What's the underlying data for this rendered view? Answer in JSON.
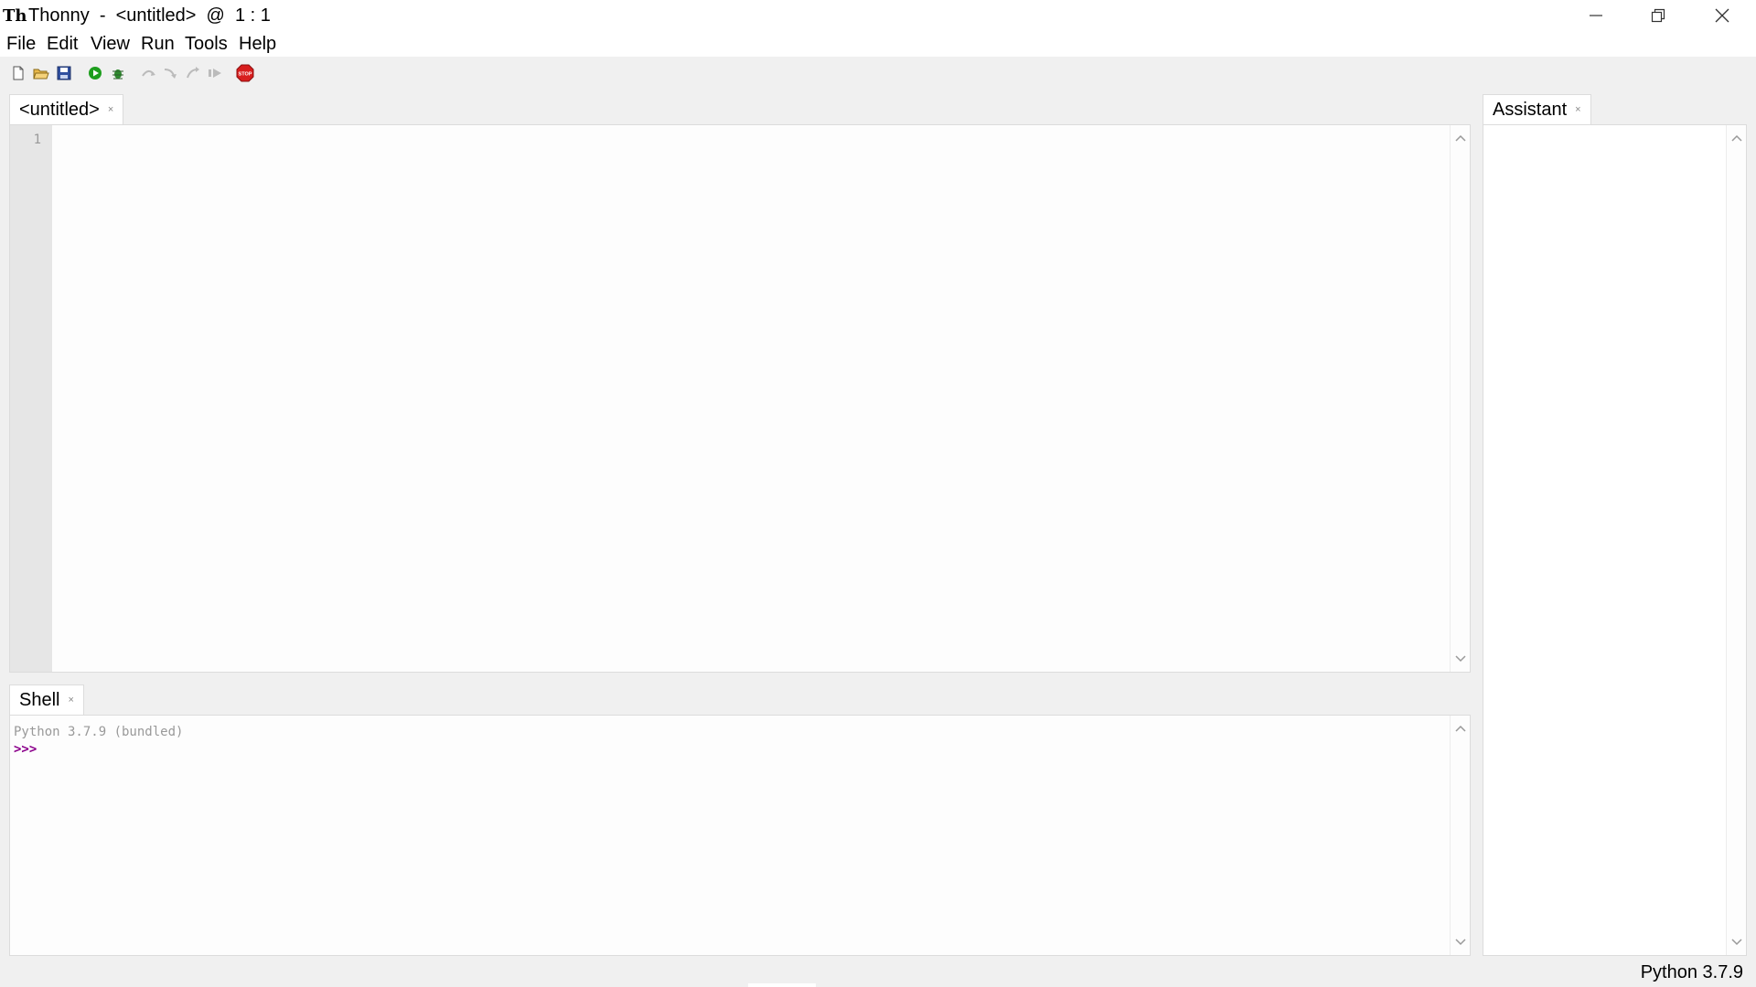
{
  "window": {
    "title": "Thonny  -  <untitled>  @  1 : 1",
    "logo_text": "Th",
    "logo_icon": "thonny-logo-icon"
  },
  "window_controls": {
    "minimize_icon": "minimize-icon",
    "maximize_icon": "restore-icon",
    "close_icon": "close-icon"
  },
  "menu": {
    "items": [
      "File",
      "Edit",
      "View",
      "Run",
      "Tools",
      "Help"
    ]
  },
  "toolbar": {
    "buttons": [
      {
        "icon": "new-file-icon"
      },
      {
        "icon": "open-file-icon"
      },
      {
        "icon": "save-icon"
      },
      {
        "icon": "run-icon"
      },
      {
        "icon": "debug-icon"
      },
      {
        "icon": "step-over-icon"
      },
      {
        "icon": "step-into-icon"
      },
      {
        "icon": "step-out-icon"
      },
      {
        "icon": "resume-icon"
      },
      {
        "icon": "stop-icon"
      }
    ],
    "stop_label": "STOP"
  },
  "editor": {
    "tab_label": "<untitled>",
    "tab_close": "×",
    "line_numbers": [
      "1"
    ]
  },
  "shell": {
    "tab_label": "Shell",
    "tab_close": "×",
    "banner": "Python 3.7.9 (bundled)",
    "prompt": ">>>"
  },
  "assistant": {
    "tab_label": "Assistant",
    "tab_close": "×"
  },
  "status": {
    "interpreter": "Python 3.7.9"
  },
  "colors": {
    "prompt": "#8b008b",
    "banner": "#999999",
    "run_green": "#1e9e1e",
    "stop_red": "#d81e1e"
  }
}
